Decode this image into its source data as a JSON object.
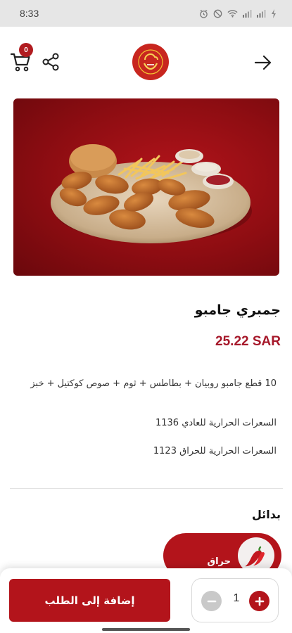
{
  "status_bar": {
    "time": "8:33",
    "icons": [
      "alarm-icon",
      "no-disturb-icon",
      "wifi-icon",
      "signal-icon",
      "signal-icon",
      "battery-charging-icon"
    ]
  },
  "header": {
    "cart_badge_count": "0",
    "icons": {
      "cart": "cart-icon",
      "share": "share-icon",
      "back": "arrow-right-icon",
      "logo": "brand-logo"
    }
  },
  "product": {
    "name": "جمبري جامبو",
    "price": "25.22 SAR",
    "description": "10 قطع جامبو روبيان + بطاطس + ثوم + صوص كوكتيل + خبز",
    "calories_regular": "السعرات الحرارية للعادي 1136",
    "calories_spicy": "السعرات الحرارية للحراق 1123"
  },
  "alternatives": {
    "title": "بدائل",
    "options": [
      {
        "label": "حراق",
        "icon": "chili-pepper-icon",
        "selected": true
      }
    ]
  },
  "bottom_bar": {
    "add_button_label": "إضافة إلى الطلب",
    "quantity": "1"
  },
  "colors": {
    "brand_red": "#b3141b",
    "price_red": "#a6182a",
    "status_bar_bg": "#e6e6e6"
  }
}
